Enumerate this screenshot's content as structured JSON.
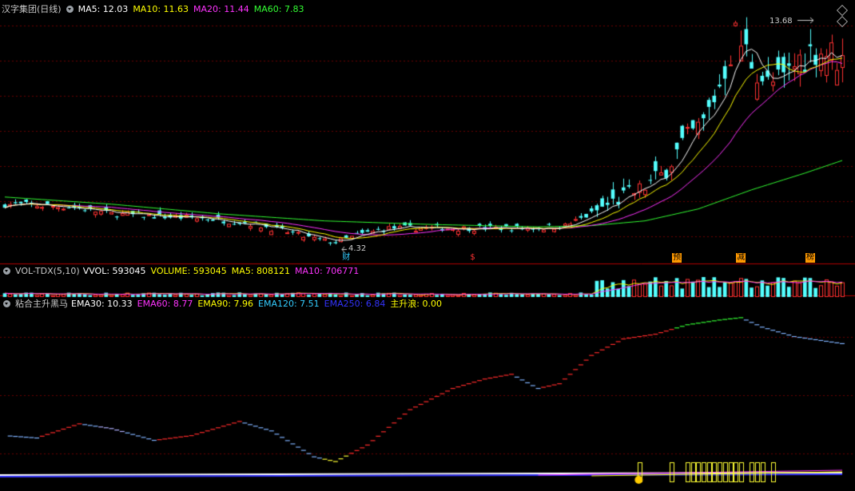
{
  "main": {
    "title": "汉字集团(日线)",
    "ma": [
      {
        "label": "MA5: 12.03",
        "color": "#ffffff"
      },
      {
        "label": "MA10: 11.63",
        "color": "#ffff00"
      },
      {
        "label": "MA20: 11.44",
        "color": "#ff33ff"
      },
      {
        "label": "MA60: 7.83",
        "color": "#33ff33"
      }
    ],
    "high_label": "13.68",
    "low_label": "4.32",
    "events": [
      {
        "text": "财",
        "color": "#33ccff",
        "bg": "",
        "day": 64
      },
      {
        "text": "$",
        "color": "#ff3333",
        "bg": "",
        "day": 88
      },
      {
        "text": "预",
        "color": "#000000",
        "bg": "#ff9900",
        "day": 126
      },
      {
        "text": "减",
        "color": "#000000",
        "bg": "#ff9900",
        "day": 138
      },
      {
        "text": "榜",
        "color": "#000000",
        "bg": "#ff9900",
        "day": 151
      }
    ]
  },
  "volume": {
    "title": "VOL-TDX(5,10)",
    "items": [
      {
        "label": "VVOL: 593045",
        "color": "#ffffff"
      },
      {
        "label": "VOLUME: 593045",
        "color": "#ffff00"
      },
      {
        "label": "MA5: 808121",
        "color": "#ffff00"
      },
      {
        "label": "MA10: 706771",
        "color": "#ff33ff"
      }
    ]
  },
  "indicator": {
    "title": "粘合主升黑马",
    "items": [
      {
        "label": "EMA30: 10.33",
        "color": "#ffffff"
      },
      {
        "label": "EMA60: 8.77",
        "color": "#ff33ff"
      },
      {
        "label": "EMA90: 7.96",
        "color": "#ffff00"
      },
      {
        "label": "EMA120: 7.51",
        "color": "#33ccff"
      },
      {
        "label": "EMA250: 6.84",
        "color": "#3333ff"
      },
      {
        "label": "主升浪: 0.00",
        "color": "#ffff00"
      }
    ]
  },
  "chart_data": {
    "type": "candlestick",
    "days": 158,
    "price_range": [
      4.32,
      13.68
    ],
    "price_waypoints": [
      [
        0,
        6.0
      ],
      [
        12,
        5.9
      ],
      [
        20,
        5.6
      ],
      [
        28,
        5.5
      ],
      [
        38,
        5.4
      ],
      [
        46,
        5.2
      ],
      [
        52,
        4.9
      ],
      [
        57,
        4.6
      ],
      [
        62,
        4.4
      ],
      [
        66,
        4.7
      ],
      [
        72,
        5.0
      ],
      [
        80,
        5.0
      ],
      [
        90,
        5.0
      ],
      [
        100,
        5.0
      ],
      [
        105,
        5.1
      ],
      [
        110,
        5.6
      ],
      [
        115,
        6.2
      ],
      [
        119,
        6.6
      ],
      [
        123,
        7.2
      ],
      [
        127,
        8.5
      ],
      [
        131,
        9.4
      ],
      [
        134,
        11.0
      ],
      [
        137,
        13.1
      ],
      [
        140,
        12.0
      ],
      [
        143,
        11.0
      ],
      [
        146,
        11.2
      ],
      [
        149,
        12.1
      ],
      [
        152,
        12.5
      ],
      [
        155,
        12.3
      ],
      [
        157,
        12.0
      ]
    ],
    "ma60_waypoints": [
      [
        0,
        6.3
      ],
      [
        20,
        6.0
      ],
      [
        40,
        5.6
      ],
      [
        60,
        5.3
      ],
      [
        80,
        5.15
      ],
      [
        100,
        5.05
      ],
      [
        110,
        5.1
      ],
      [
        120,
        5.3
      ],
      [
        130,
        5.8
      ],
      [
        140,
        6.6
      ],
      [
        150,
        7.3
      ],
      [
        157,
        7.83
      ]
    ],
    "indicator_waypoints": [
      [
        0,
        6.4
      ],
      [
        6,
        6.3
      ],
      [
        14,
        6.9
      ],
      [
        20,
        6.7
      ],
      [
        28,
        6.2
      ],
      [
        35,
        6.4
      ],
      [
        44,
        7.0
      ],
      [
        50,
        6.6
      ],
      [
        58,
        5.5
      ],
      [
        62,
        5.3
      ],
      [
        68,
        6.0
      ],
      [
        76,
        7.5
      ],
      [
        84,
        8.4
      ],
      [
        90,
        8.8
      ],
      [
        95,
        9.0
      ],
      [
        100,
        8.4
      ],
      [
        104,
        8.6
      ],
      [
        110,
        9.8
      ],
      [
        116,
        10.5
      ],
      [
        122,
        10.7
      ],
      [
        128,
        11.1
      ],
      [
        134,
        11.3
      ],
      [
        138,
        11.4
      ],
      [
        142,
        11.0
      ],
      [
        148,
        10.6
      ],
      [
        157,
        10.3
      ]
    ],
    "indicator_range": [
      5.0,
      11.6
    ],
    "signal_days": [
      119,
      125,
      128,
      129,
      130,
      131,
      132,
      133,
      134,
      135,
      136,
      137,
      138,
      140,
      141,
      142,
      144
    ]
  }
}
